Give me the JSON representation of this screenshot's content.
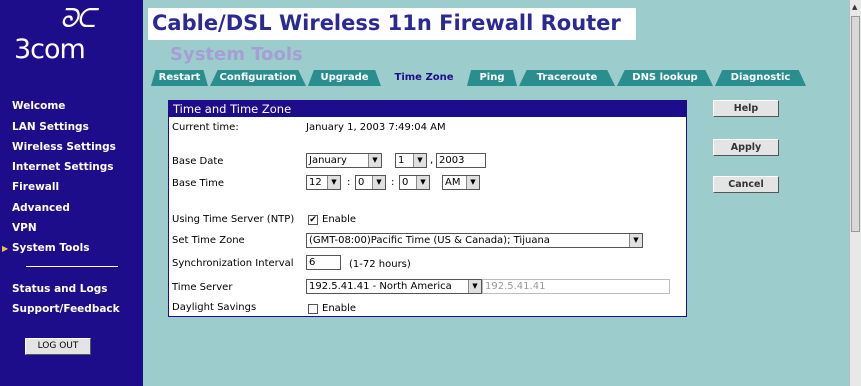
{
  "logo": {
    "mark": "ᘐᑕ",
    "word": "3com"
  },
  "sidebar": {
    "items": [
      {
        "label": "Welcome"
      },
      {
        "label": "LAN Settings"
      },
      {
        "label": "Wireless Settings"
      },
      {
        "label": "Internet Settings"
      },
      {
        "label": "Firewall"
      },
      {
        "label": "Advanced"
      },
      {
        "label": "VPN"
      },
      {
        "label": "System Tools",
        "active": true
      },
      {
        "label": "Status and Logs"
      },
      {
        "label": "Support/Feedback"
      }
    ],
    "logout_label": "LOG OUT"
  },
  "header": {
    "title": "Cable/DSL Wireless 11n Firewall Router",
    "section": "System Tools"
  },
  "tabs": [
    {
      "label": "Restart"
    },
    {
      "label": "Configuration"
    },
    {
      "label": "Upgrade"
    },
    {
      "label": "Time Zone",
      "active": true
    },
    {
      "label": "Ping"
    },
    {
      "label": "Traceroute"
    },
    {
      "label": "DNS lookup"
    },
    {
      "label": "Diagnostic"
    }
  ],
  "panel": {
    "title": "Time and Time Zone",
    "current_time_label": "Current time:",
    "current_time_value": "January 1, 2003 7:49:04 AM",
    "base_date_label": "Base Date",
    "base_date": {
      "month": "January",
      "day": "1",
      "year": "2003",
      "comma": ","
    },
    "base_time_label": "Base Time",
    "base_time": {
      "hour": "12",
      "minute": "0",
      "second": "0",
      "ampm": "AM",
      "colon": ":"
    },
    "ntp_label": "Using Time Server (NTP)",
    "ntp_enable_label": "Enable",
    "ntp_enabled": true,
    "timezone_label": "Set Time Zone",
    "timezone_value": "(GMT-08:00)Pacific Time (US & Canada); Tijuana",
    "sync_label": "Synchronization Interval",
    "sync_value": "6",
    "sync_hint": "(1-72 hours)",
    "server_label": "Time Server",
    "server_select": "192.5.41.41 - North America",
    "server_text": "192.5.41.41",
    "dst_label": "Daylight Savings",
    "dst_enable_label": "Enable",
    "dst_enabled": false
  },
  "buttons": {
    "help": "Help",
    "apply": "Apply",
    "cancel": "Cancel"
  },
  "icons": {
    "dropdown": "▼",
    "check": "✔",
    "active_arrow": "▶",
    "scroll_up": "▲"
  },
  "colors": {
    "sidebar": "#1e0d8a",
    "background": "#9ccccc",
    "tab": "#2b8e8e",
    "title_text": "#2b2a94",
    "accent": "#f5c242"
  }
}
